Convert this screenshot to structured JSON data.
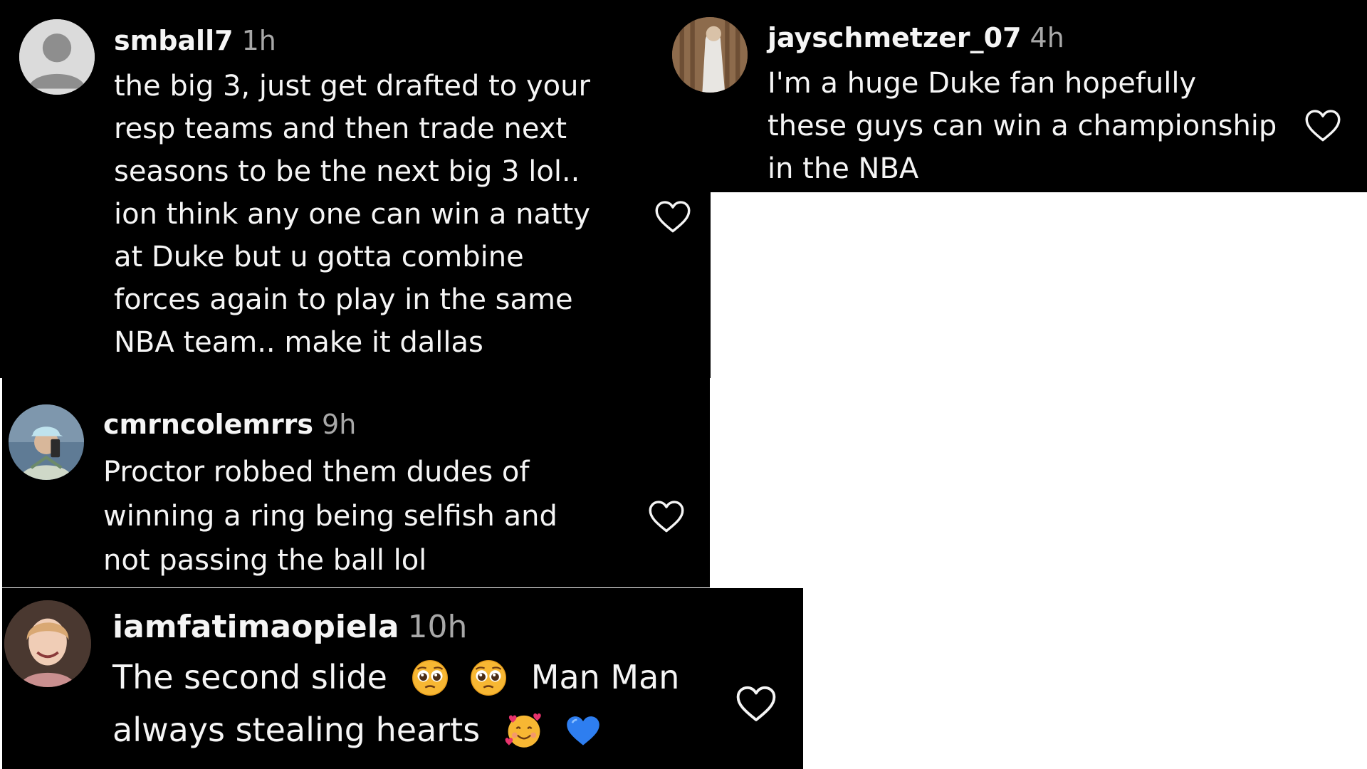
{
  "comments": [
    {
      "username": "smball7",
      "time": "1h",
      "text": "the big 3, just get drafted to your\nresp teams and then trade next\nseasons to be the next big 3 lol..\nion think any one can win a natty\nat Duke but u gotta combine\nforces again to play in the same\nNBA team.. make it dallas",
      "avatar": "default-avatar-icon"
    },
    {
      "username": "jayschmetzer_07",
      "time": "4h",
      "text": "I'm a huge Duke fan hopefully\nthese guys can win a championship\nin the NBA",
      "avatar": "photo-avatar"
    },
    {
      "username": "cmrncolemrrs",
      "time": "9h",
      "text": "Proctor robbed them dudes of\nwinning a ring being selfish and\nnot passing the ball lol",
      "avatar": "photo-avatar"
    },
    {
      "username": "iamfatimaopiela",
      "time": "10h",
      "line1": "The second slide",
      "line1b": "Man Man",
      "line2": "always stealing hearts",
      "avatar": "photo-avatar",
      "emojis": [
        "pleading-face-emoji",
        "pleading-face-emoji",
        "smiling-face-with-hearts-emoji",
        "blue-heart-emoji"
      ]
    }
  ],
  "colors": {
    "background": "#000000",
    "text": "#f5f5f5",
    "timestamp": "#a8a8a8",
    "page": "#ffffff"
  },
  "icons": {
    "like": "heart-outline-icon"
  }
}
